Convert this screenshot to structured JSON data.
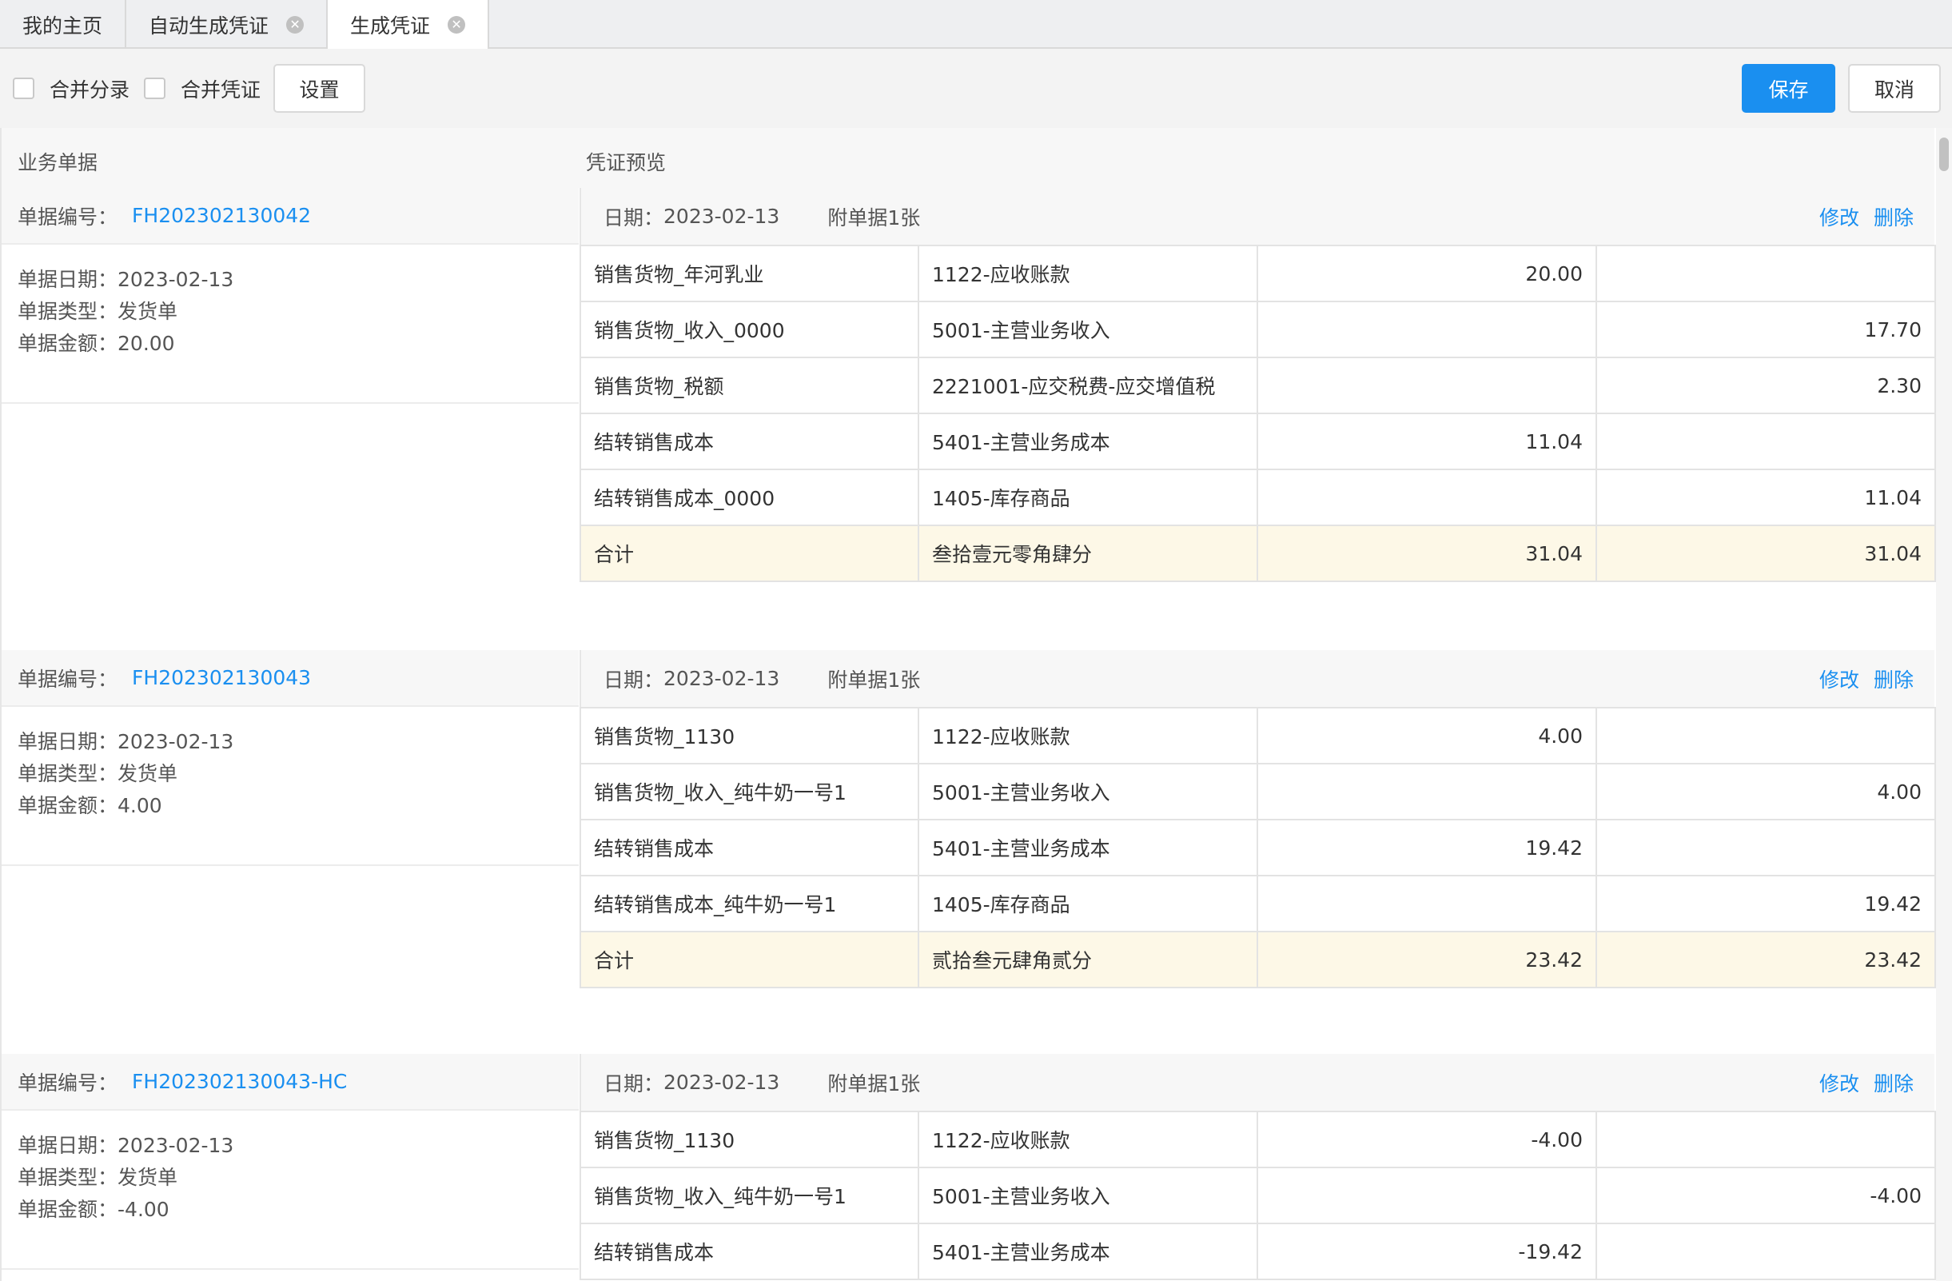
{
  "tabs": [
    {
      "label": "我的主页",
      "closable": false,
      "active": false
    },
    {
      "label": "自动生成凭证",
      "closable": true,
      "active": false
    },
    {
      "label": "生成凭证",
      "closable": true,
      "active": true
    }
  ],
  "toolbar": {
    "merge_entries_label": "合并分录",
    "merge_vouchers_label": "合并凭证",
    "settings_label": "设置",
    "save_label": "保存",
    "cancel_label": "取消"
  },
  "columns": {
    "business_docs": "业务单据",
    "voucher_preview": "凭证预览"
  },
  "labels": {
    "bill_no": "单据编号：",
    "bill_date": "单据日期：",
    "bill_type": "单据类型：",
    "bill_amount": "单据金额：",
    "date": "日期：",
    "edit": "修改",
    "delete": "删除"
  },
  "blocks": [
    {
      "bill_no": "FH202302130042",
      "bill_date": "2023-02-13",
      "bill_type": "发货单",
      "bill_amount": "20.00",
      "voucher_date": "2023-02-13",
      "attachments": "附单据1张",
      "rows": [
        {
          "summary": "销售货物_年河乳业",
          "account": "1122-应收账款",
          "debit": "20.00",
          "credit": ""
        },
        {
          "summary": "销售货物_收入_0000",
          "account": "5001-主营业务收入",
          "debit": "",
          "credit": "17.70"
        },
        {
          "summary": "销售货物_税额",
          "account": "2221001-应交税费-应交增值税",
          "debit": "",
          "credit": "2.30"
        },
        {
          "summary": "结转销售成本",
          "account": "5401-主营业务成本",
          "debit": "11.04",
          "credit": ""
        },
        {
          "summary": "结转销售成本_0000",
          "account": "1405-库存商品",
          "debit": "",
          "credit": "11.04"
        }
      ],
      "total": {
        "label": "合计",
        "in_words": "叁拾壹元零角肆分",
        "debit": "31.04",
        "credit": "31.04"
      }
    },
    {
      "bill_no": "FH202302130043",
      "bill_date": "2023-02-13",
      "bill_type": "发货单",
      "bill_amount": "4.00",
      "voucher_date": "2023-02-13",
      "attachments": "附单据1张",
      "rows": [
        {
          "summary": "销售货物_1130",
          "account": "1122-应收账款",
          "debit": "4.00",
          "credit": ""
        },
        {
          "summary": "销售货物_收入_纯牛奶一号1",
          "account": "5001-主营业务收入",
          "debit": "",
          "credit": "4.00"
        },
        {
          "summary": "结转销售成本",
          "account": "5401-主营业务成本",
          "debit": "19.42",
          "credit": ""
        },
        {
          "summary": "结转销售成本_纯牛奶一号1",
          "account": "1405-库存商品",
          "debit": "",
          "credit": "19.42"
        }
      ],
      "total": {
        "label": "合计",
        "in_words": "贰拾叁元肆角贰分",
        "debit": "23.42",
        "credit": "23.42"
      }
    },
    {
      "bill_no": "FH202302130043-HC",
      "bill_date": "2023-02-13",
      "bill_type": "发货单",
      "bill_amount": "-4.00",
      "voucher_date": "2023-02-13",
      "attachments": "附单据1张",
      "rows": [
        {
          "summary": "销售货物_1130",
          "account": "1122-应收账款",
          "debit": "-4.00",
          "credit": ""
        },
        {
          "summary": "销售货物_收入_纯牛奶一号1",
          "account": "5001-主营业务收入",
          "debit": "",
          "credit": "-4.00"
        },
        {
          "summary": "结转销售成本",
          "account": "5401-主营业务成本",
          "debit": "-19.42",
          "credit": ""
        }
      ],
      "total": null
    }
  ],
  "colors": {
    "accent": "#1a8ff0",
    "total_row_bg": "#fdf8e7"
  }
}
